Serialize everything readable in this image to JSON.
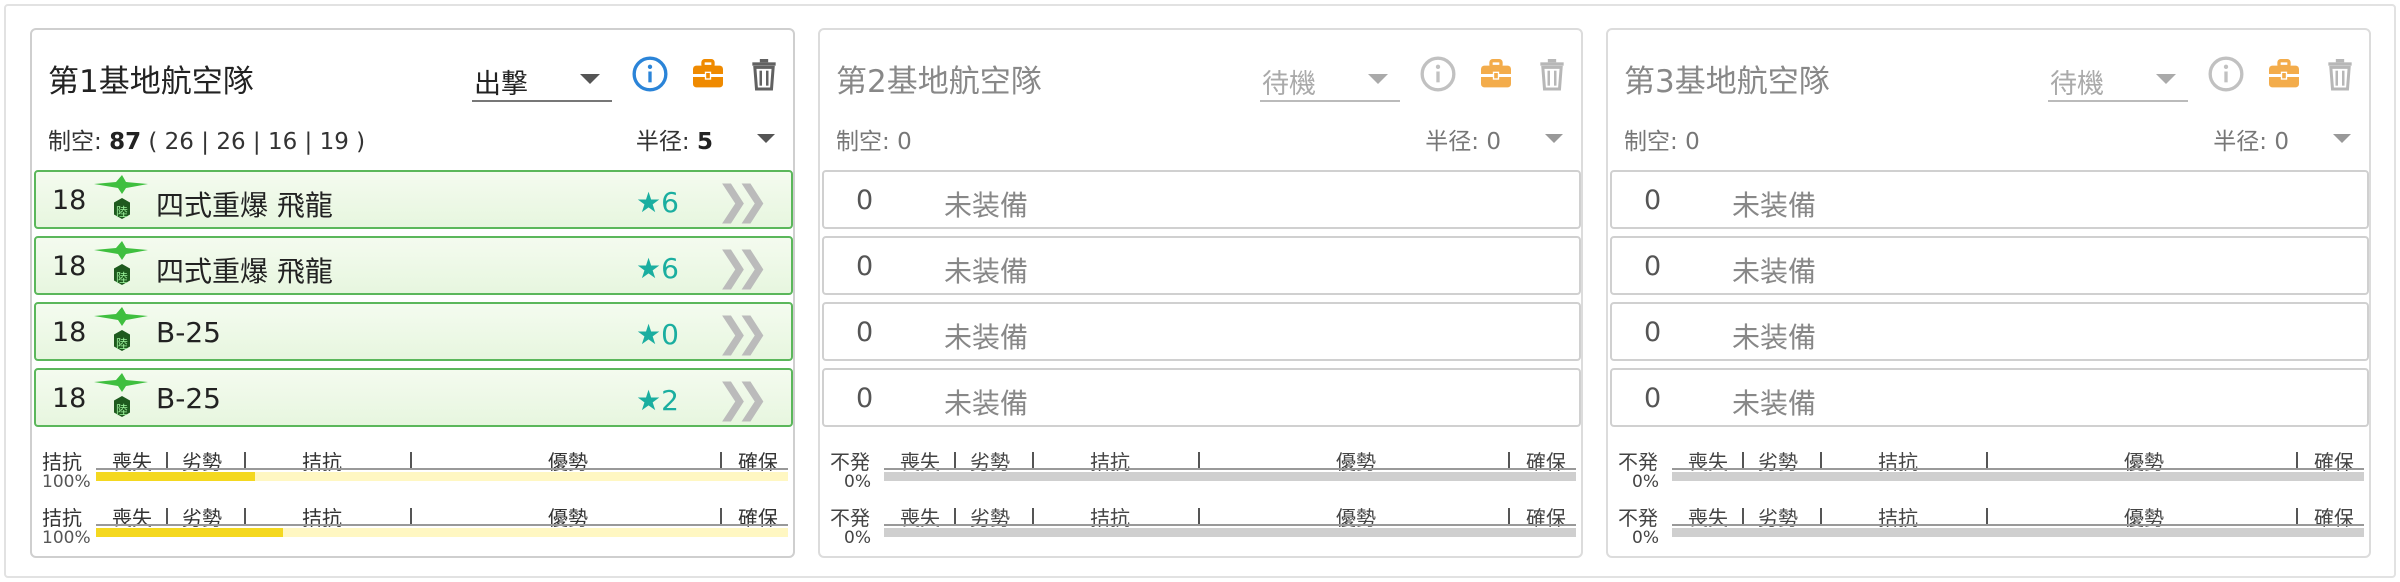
{
  "colors": {
    "accent_blue": "#2b84d8",
    "briefcase_orange": "#ef8a00",
    "trash_gray": "#616161",
    "filled_border_green": "#5bb75b",
    "star_teal": "#1aaea0",
    "bar_fill_yellow": "#f4d820",
    "bar_track_yellow": "#fff7c2",
    "bar_track_gray": "#cfcfcf"
  },
  "icons": {
    "info": "info-circle-icon",
    "briefcase": "briefcase-icon",
    "trash": "trash-icon",
    "plane": "land-based-plane-icon",
    "chevron": "double-chevron-right-icon"
  },
  "bar_scale": {
    "labels": [
      "喪失",
      "劣勢",
      "拮抗",
      "優勢",
      "確保"
    ]
  },
  "panels": [
    {
      "title": "第1基地航空隊",
      "mode": "出撃",
      "air_power_label": "制空: ",
      "air_power_value": "87",
      "air_power_breakdown": "( 26 | 26 | 16 | 19 )",
      "radius_label": "半径: ",
      "radius_value": "5",
      "slots": [
        {
          "count": "18",
          "name": "四式重爆 飛龍",
          "star": "★6",
          "icon_label": "陸"
        },
        {
          "count": "18",
          "name": "四式重爆 飛龍",
          "star": "★6",
          "icon_label": "陸"
        },
        {
          "count": "18",
          "name": "B-25",
          "star": "★0",
          "icon_label": "陸"
        },
        {
          "count": "18",
          "name": "B-25",
          "star": "★2",
          "icon_label": "陸"
        }
      ],
      "bars": [
        {
          "status": "拮抗",
          "percent": "100%",
          "fill": 0.23
        },
        {
          "status": "拮抗",
          "percent": "100%",
          "fill": 0.27
        }
      ]
    },
    {
      "title": "第2基地航空隊",
      "mode": "待機",
      "air_power_label": "制空: ",
      "air_power_value": "0",
      "air_power_breakdown": "",
      "radius_label": "半径: ",
      "radius_value": "0",
      "slots": [
        {
          "count": "0",
          "name": "未装備"
        },
        {
          "count": "0",
          "name": "未装備"
        },
        {
          "count": "0",
          "name": "未装備"
        },
        {
          "count": "0",
          "name": "未装備"
        }
      ],
      "bars": [
        {
          "status": "不発",
          "percent": "0%",
          "fill": 0
        },
        {
          "status": "不発",
          "percent": "0%",
          "fill": 0
        }
      ]
    },
    {
      "title": "第3基地航空隊",
      "mode": "待機",
      "air_power_label": "制空: ",
      "air_power_value": "0",
      "air_power_breakdown": "",
      "radius_label": "半径: ",
      "radius_value": "0",
      "slots": [
        {
          "count": "0",
          "name": "未装備"
        },
        {
          "count": "0",
          "name": "未装備"
        },
        {
          "count": "0",
          "name": "未装備"
        },
        {
          "count": "0",
          "name": "未装備"
        }
      ],
      "bars": [
        {
          "status": "不発",
          "percent": "0%",
          "fill": 0
        },
        {
          "status": "不発",
          "percent": "0%",
          "fill": 0
        }
      ]
    }
  ]
}
